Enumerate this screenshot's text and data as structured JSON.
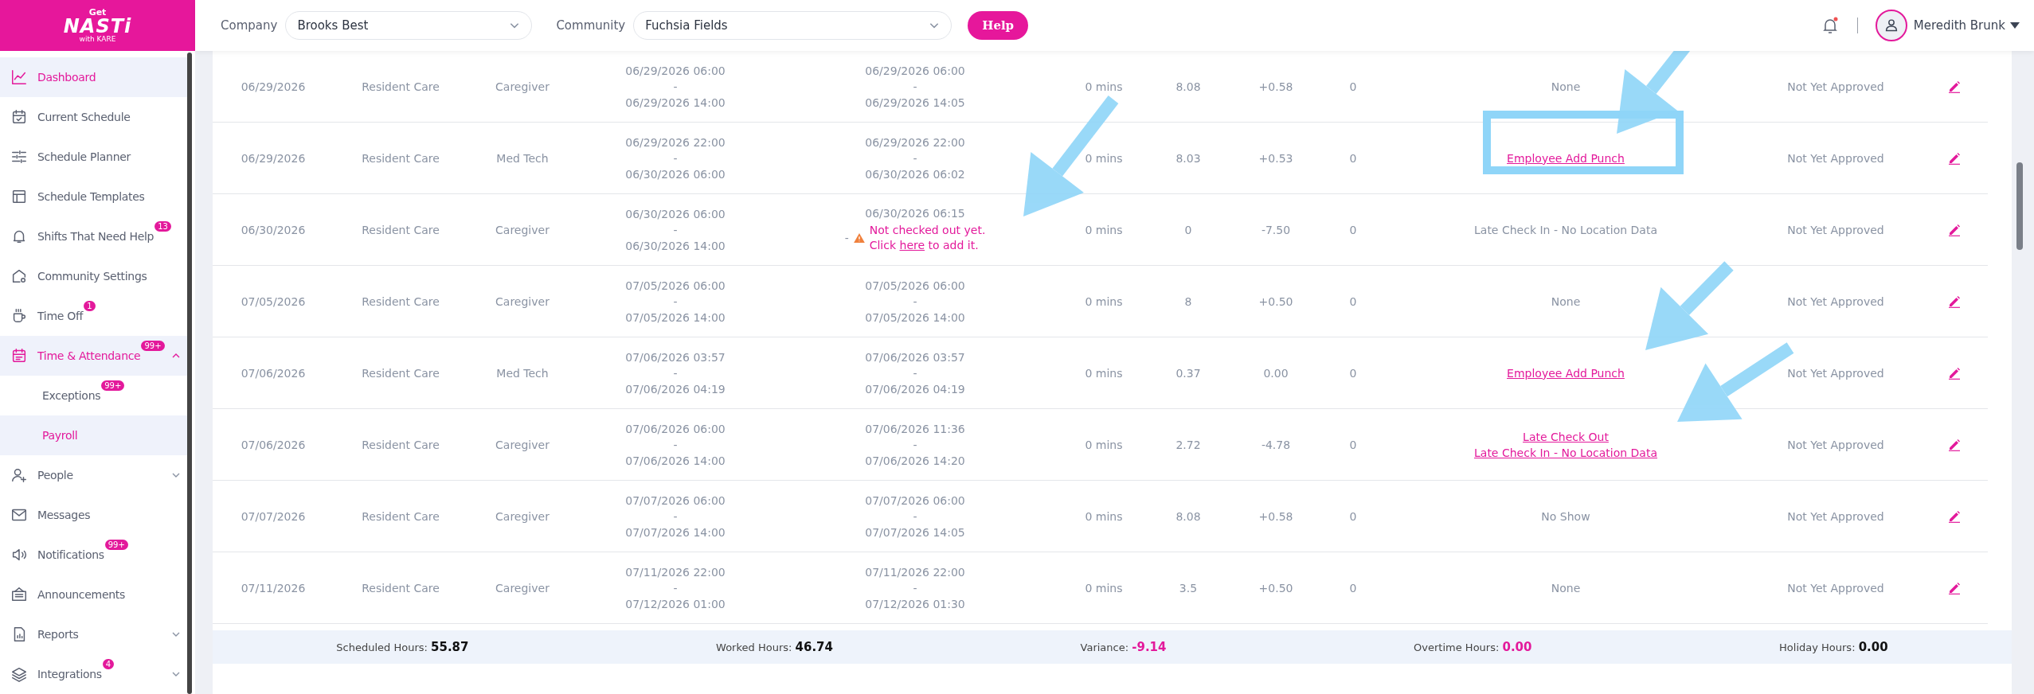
{
  "logo": {
    "top": "Get",
    "main": "NASTi",
    "sub": "with KARE"
  },
  "sidebar": {
    "items": [
      {
        "kind": "chart",
        "label": "Dashboard",
        "selected": true
      },
      {
        "kind": "calendar-check",
        "label": "Current Schedule",
        "selected": false
      },
      {
        "kind": "sliders",
        "label": "Schedule Planner",
        "selected": false
      },
      {
        "kind": "layout",
        "label": "Schedule Templates",
        "selected": false
      },
      {
        "kind": "bell",
        "label": "Shifts That Need Help",
        "selected": false,
        "badge": "13"
      },
      {
        "kind": "house-gear",
        "label": "Community Settings",
        "selected": false
      },
      {
        "kind": "cup",
        "label": "Time Off",
        "selected": false,
        "badge": "1"
      },
      {
        "kind": "calendar",
        "label": "Time & Attendance",
        "selected": true,
        "badge": "99+",
        "expanded": true,
        "children": [
          {
            "label": "Exceptions",
            "selected": false,
            "badge": "99+"
          },
          {
            "label": "Payroll",
            "selected": true
          }
        ]
      },
      {
        "kind": "person-plus",
        "label": "People",
        "selected": false,
        "expanded": false
      },
      {
        "kind": "mail",
        "label": "Messages",
        "selected": false
      },
      {
        "kind": "speaker",
        "label": "Notifications",
        "selected": false,
        "badge": "99+"
      },
      {
        "kind": "board",
        "label": "Announcements",
        "selected": false
      },
      {
        "kind": "report",
        "label": "Reports",
        "selected": false,
        "expanded": false
      },
      {
        "kind": "layers",
        "label": "Integrations",
        "selected": false,
        "badge": "4",
        "expanded": false
      }
    ]
  },
  "topbar": {
    "company_label": "Company",
    "company": "Brooks Best",
    "community_label": "Community",
    "community": "Fuchsia Fields",
    "help": "Help",
    "notification_dot": true,
    "user": "Meredith Brunk"
  },
  "table": {
    "rows": [
      {
        "date": "06/29/2026",
        "department": "Resident Care",
        "role": "Caregiver",
        "scheduled": [
          "06/29/2026 06:00",
          "-",
          "06/29/2026 14:00"
        ],
        "actual": [
          "06/29/2026 06:00",
          "-",
          "06/29/2026 14:05"
        ],
        "break": "0 mins",
        "worked": "8.08",
        "variance": "+0.58",
        "overtime": "0",
        "exceptions": {
          "kind": "text",
          "items": [
            "None"
          ]
        },
        "status": "Not Yet Approved"
      },
      {
        "date": "06/29/2026",
        "department": "Resident Care",
        "role": "Med Tech",
        "scheduled": [
          "06/29/2026 22:00",
          "-",
          "06/30/2026 06:00"
        ],
        "actual": [
          "06/29/2026 22:00",
          "-",
          "06/30/2026 06:02"
        ],
        "break": "0 mins",
        "worked": "8.03",
        "variance": "+0.53",
        "overtime": "0",
        "exceptions": {
          "kind": "link",
          "items": [
            "Employee Add Punch"
          ]
        },
        "status": "Not Yet Approved"
      },
      {
        "date": "06/30/2026",
        "department": "Resident Care",
        "role": "Caregiver",
        "scheduled": [
          "06/30/2026 06:00",
          "-",
          "06/30/2026 14:00"
        ],
        "actual": [
          "06/30/2026 06:15"
        ],
        "missing_checkout": {
          "dash": "-",
          "line1": "Not checked out yet.",
          "before": "Click",
          "link": "here",
          "after": "to add it."
        },
        "break": "0 mins",
        "worked": "0",
        "variance": "-7.50",
        "overtime": "0",
        "exceptions": {
          "kind": "text",
          "items": [
            "Late Check In - No Location Data"
          ]
        },
        "status": "Not Yet Approved"
      },
      {
        "date": "07/05/2026",
        "department": "Resident Care",
        "role": "Caregiver",
        "scheduled": [
          "07/05/2026 06:00",
          "-",
          "07/05/2026 14:00"
        ],
        "actual": [
          "07/05/2026 06:00",
          "-",
          "07/05/2026 14:00"
        ],
        "break": "0 mins",
        "worked": "8",
        "variance": "+0.50",
        "overtime": "0",
        "exceptions": {
          "kind": "text",
          "items": [
            "None"
          ]
        },
        "status": "Not Yet Approved"
      },
      {
        "date": "07/06/2026",
        "department": "Resident Care",
        "role": "Med Tech",
        "scheduled": [
          "07/06/2026 03:57",
          "-",
          "07/06/2026 04:19"
        ],
        "actual": [
          "07/06/2026 03:57",
          "-",
          "07/06/2026 04:19"
        ],
        "break": "0 mins",
        "worked": "0.37",
        "variance": "0.00",
        "overtime": "0",
        "exceptions": {
          "kind": "link",
          "items": [
            "Employee Add Punch"
          ]
        },
        "status": "Not Yet Approved"
      },
      {
        "date": "07/06/2026",
        "department": "Resident Care",
        "role": "Caregiver",
        "scheduled": [
          "07/06/2026 06:00",
          "-",
          "07/06/2026 14:00"
        ],
        "actual": [
          "07/06/2026 11:36",
          "-",
          "07/06/2026 14:20"
        ],
        "break": "0 mins",
        "worked": "2.72",
        "variance": "-4.78",
        "overtime": "0",
        "exceptions": {
          "kind": "link",
          "items": [
            "Late Check Out",
            "Late Check In - No Location Data"
          ]
        },
        "status": "Not Yet Approved"
      },
      {
        "date": "07/07/2026",
        "department": "Resident Care",
        "role": "Caregiver",
        "scheduled": [
          "07/07/2026 06:00",
          "-",
          "07/07/2026 14:00"
        ],
        "actual": [
          "07/07/2026 06:00",
          "-",
          "07/07/2026 14:05"
        ],
        "break": "0 mins",
        "worked": "8.08",
        "variance": "+0.58",
        "overtime": "0",
        "exceptions": {
          "kind": "text",
          "items": [
            "No Show"
          ]
        },
        "status": "Not Yet Approved"
      },
      {
        "date": "07/11/2026",
        "department": "Resident Care",
        "role": "Caregiver",
        "scheduled": [
          "07/11/2026 22:00",
          "-",
          "07/12/2026 01:00"
        ],
        "actual": [
          "07/11/2026 22:00",
          "-",
          "07/12/2026 01:30"
        ],
        "break": "0 mins",
        "worked": "3.5",
        "variance": "+0.50",
        "overtime": "0",
        "exceptions": {
          "kind": "text",
          "items": [
            "None"
          ]
        },
        "status": "Not Yet Approved"
      }
    ]
  },
  "summary": [
    {
      "label": "Scheduled Hours:",
      "value": "55.87",
      "highlight": false
    },
    {
      "label": "Worked Hours:",
      "value": "46.74",
      "highlight": false
    },
    {
      "label": "Variance:",
      "value": "-9.14",
      "highlight": true
    },
    {
      "label": "Overtime Hours:",
      "value": "0.00",
      "highlight": true
    },
    {
      "label": "Holiday Hours:",
      "value": "0.00",
      "highlight": false
    }
  ]
}
